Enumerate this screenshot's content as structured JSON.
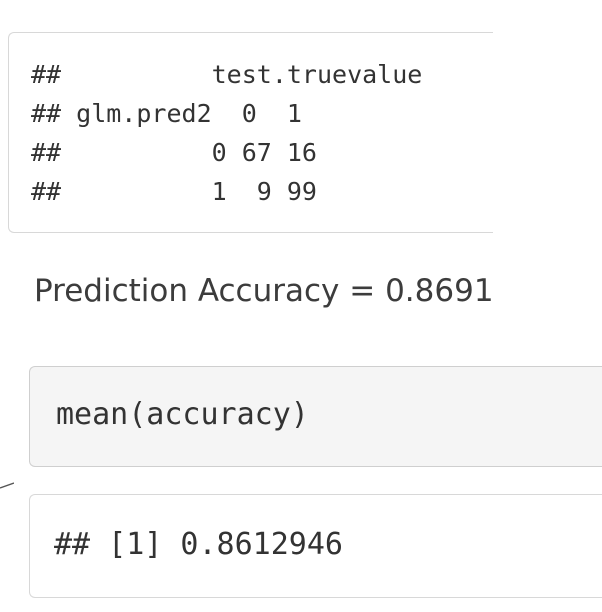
{
  "confusion_output": {
    "lines": [
      "##          test.truevalue",
      "## glm.pred2  0  1",
      "##          0 67 16",
      "##          1  9 99"
    ]
  },
  "prose": {
    "accuracy_text": "Prediction Accuracy = 0.8691"
  },
  "input_chunk": {
    "code": "mean(accuracy)"
  },
  "result_chunk": {
    "output": "## [1] 0.8612946"
  }
}
